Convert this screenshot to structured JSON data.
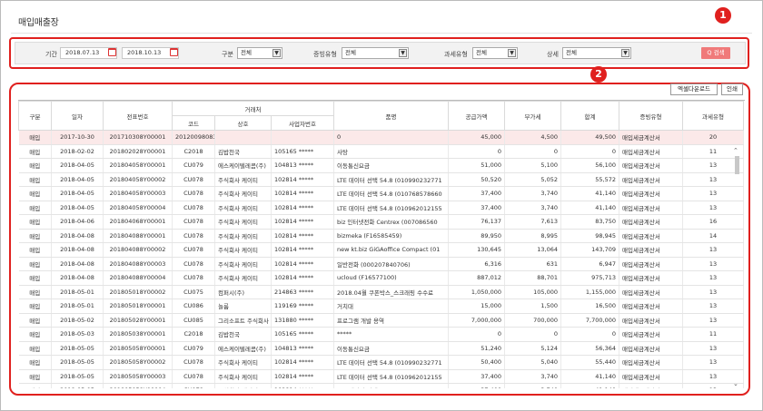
{
  "page": {
    "title": "매입매출장"
  },
  "filter": {
    "period_label": "기간",
    "date_from": "2018.07.13",
    "date_sep": "~",
    "date_to": "2018.10.13",
    "category_label": "구분",
    "category_value": "전체",
    "evidence_label": "증빙유형",
    "evidence_value": "전체",
    "tax_label": "과세유형",
    "tax_value": "전체",
    "status_label": "상세",
    "status_value": "전체",
    "search_label": "Q 검색"
  },
  "annotations": {
    "badge1": "1",
    "badge2": "2"
  },
  "toolbar": {
    "excel_label": "엑셀다운로드",
    "print_label": "인쇄"
  },
  "table": {
    "headers": {
      "type": "구분",
      "date": "일자",
      "voucher": "전표번호",
      "partner": "거래처",
      "code": "코드",
      "name": "상호",
      "bizno": "사업자번호",
      "item": "품명",
      "supply": "공급가액",
      "vat": "부가세",
      "total": "합계",
      "evidence": "증빙유형",
      "taxtype": "과세유형"
    },
    "rows": [
      [
        "매입",
        "2017-10-30",
        "201710308Y00001",
        "201200980834",
        "",
        "",
        "0",
        "45,000",
        "4,500",
        "49,500",
        "매입세금계산서",
        "20"
      ],
      [
        "매입",
        "2018-02-02",
        "201802028Y00001",
        "C2018",
        "김밥천국",
        "105165 *****",
        "사탕",
        "0",
        "0",
        "0",
        "매입세금계산서",
        "11"
      ],
      [
        "매입",
        "2018-04-05",
        "201804058Y00001",
        "CU079",
        "에스케이텔레콤(주)",
        "104813 *****",
        "이동통신요금",
        "51,000",
        "5,100",
        "56,100",
        "매입세금계산서",
        "13"
      ],
      [
        "매입",
        "2018-04-05",
        "201804058Y00002",
        "CU078",
        "주식회사 케이티",
        "102814 *****",
        "LTE 데이터 선택 54.8 (010990232771",
        "50,520",
        "5,052",
        "55,572",
        "매입세금계산서",
        "13"
      ],
      [
        "매입",
        "2018-04-05",
        "201804058Y00003",
        "CU078",
        "주식회사 케이티",
        "102814 *****",
        "LTE 데이터 선택 54.8 (010768578660",
        "37,400",
        "3,740",
        "41,140",
        "매입세금계산서",
        "13"
      ],
      [
        "매입",
        "2018-04-05",
        "201804058Y00004",
        "CU078",
        "주식회사 케이티",
        "102814 *****",
        "LTE 데이터 선택 54.8 (010962012155",
        "37,400",
        "3,740",
        "41,140",
        "매입세금계산서",
        "13"
      ],
      [
        "매입",
        "2018-04-06",
        "201804068Y00001",
        "CU078",
        "주식회사 케이티",
        "102814 *****",
        "biz 인터넷전화 Centrex (007086560",
        "76,137",
        "7,613",
        "83,750",
        "매입세금계산서",
        "16"
      ],
      [
        "매입",
        "2018-04-08",
        "201804088Y00001",
        "CU078",
        "주식회사 케이티",
        "102814 *****",
        "bizmeka (F16585459)",
        "89,950",
        "8,995",
        "98,945",
        "매입세금계산서",
        "14"
      ],
      [
        "매입",
        "2018-04-08",
        "201804088Y00002",
        "CU078",
        "주식회사 케이티",
        "102814 *****",
        "new kt.biz GiGAoffice Compact (01",
        "130,645",
        "13,064",
        "143,709",
        "매입세금계산서",
        "13"
      ],
      [
        "매입",
        "2018-04-08",
        "201804088Y00003",
        "CU078",
        "주식회사 케이티",
        "102814 *****",
        "일반전화 (000207840706)",
        "6,316",
        "631",
        "6,947",
        "매입세금계산서",
        "13"
      ],
      [
        "매입",
        "2018-04-08",
        "201804088Y00004",
        "CU078",
        "주식회사 케이티",
        "102814 *****",
        "ucloud (F16577100)",
        "887,012",
        "88,701",
        "975,713",
        "매입세금계산서",
        "13"
      ],
      [
        "매입",
        "2018-05-01",
        "201805018Y00002",
        "CU075",
        "컴퍼시(주)",
        "214863 *****",
        "2018.04월 쿠폰박스_스크래핑 수수료",
        "1,050,000",
        "105,000",
        "1,155,000",
        "매입세금계산서",
        "13"
      ],
      [
        "매입",
        "2018-05-01",
        "201805018Y00001",
        "CU086",
        "놀룸",
        "119169 *****",
        "거치대",
        "15,000",
        "1,500",
        "16,500",
        "매입세금계산서",
        "13"
      ],
      [
        "매입",
        "2018-05-02",
        "201805028Y00001",
        "CU085",
        "그리소프트 주식회사",
        "131880 *****",
        "프로그램 개발 용역",
        "7,000,000",
        "700,000",
        "7,700,000",
        "매입세금계산서",
        "13"
      ],
      [
        "매입",
        "2018-05-03",
        "201805038Y00001",
        "C2018",
        "김밥천국",
        "105165 *****",
        "*****",
        "0",
        "0",
        "0",
        "매입세금계산서",
        "11"
      ],
      [
        "매입",
        "2018-05-05",
        "201805058Y00001",
        "CU079",
        "에스케이텔레콤(주)",
        "104813 *****",
        "이동통신요금",
        "51,240",
        "5,124",
        "56,364",
        "매입세금계산서",
        "13"
      ],
      [
        "매입",
        "2018-05-05",
        "201805058Y00002",
        "CU078",
        "주식회사 케이티",
        "102814 *****",
        "LTE 데이터 선택 54.8 (010990232771",
        "50,400",
        "5,040",
        "55,440",
        "매입세금계산서",
        "13"
      ],
      [
        "매입",
        "2018-05-05",
        "201805058Y00003",
        "CU078",
        "주식회사 케이티",
        "102814 *****",
        "LTE 데이터 선택 54.8 (010962012155",
        "37,400",
        "3,740",
        "41,140",
        "매입세금계산서",
        "13"
      ],
      [
        "매입",
        "2018-05-05",
        "201805058Y00004",
        "CU078",
        "주식회사 케이티",
        "102814 *****",
        "LTE 데이터 선택 54.8 (010768578660",
        "37,400",
        "3,740",
        "41,140",
        "매입세금계산서",
        "13"
      ]
    ]
  },
  "colors": {
    "accent": "#e0201e",
    "search_button": "#f07a7a",
    "row_highlight": "#fbe9e9"
  }
}
